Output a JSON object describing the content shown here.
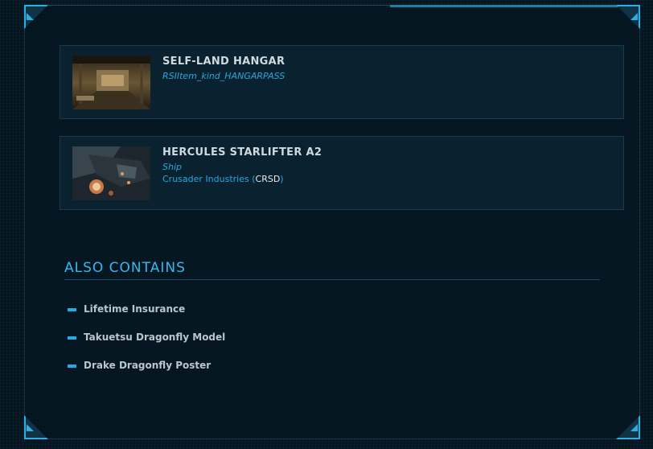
{
  "items": [
    {
      "title": "SELF-LAND HANGAR",
      "subtitle": "RSIItem_kind_HANGARPASS",
      "thumbnail_icon": "hangar-thumbnail"
    },
    {
      "title": "HERCULES STARLIFTER A2",
      "subtitle": "Ship",
      "manufacturer_name": "Crusader Industries",
      "manufacturer_open": " (",
      "manufacturer_code": "CRSD",
      "manufacturer_close": ")",
      "thumbnail_icon": "ship-thumbnail"
    }
  ],
  "also_contains": {
    "title": "ALSO CONTAINS",
    "items": [
      "Lifetime Insurance",
      "Takuetsu Dragonfly Model",
      "Drake Dragonfly Poster"
    ]
  },
  "colors": {
    "accent": "#37b8ea",
    "link": "#2aa6e0",
    "background": "#061620"
  }
}
